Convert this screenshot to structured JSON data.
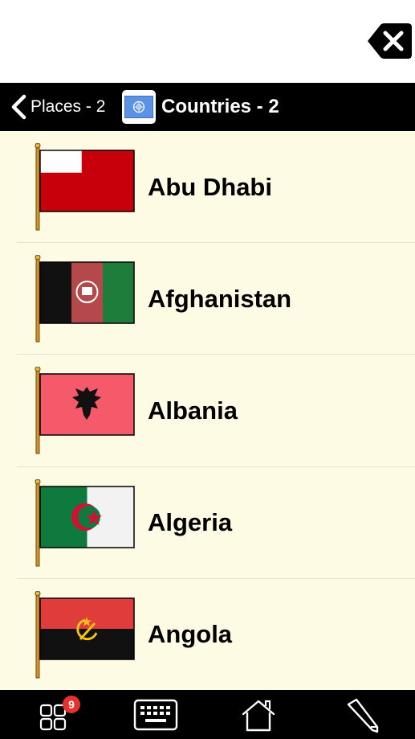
{
  "header": {
    "back_label": "Places - 2",
    "title": "Countries - 2"
  },
  "countries": [
    {
      "name": "Abu Dhabi"
    },
    {
      "name": "Afghanistan"
    },
    {
      "name": "Albania"
    },
    {
      "name": "Algeria"
    },
    {
      "name": "Angola"
    }
  ],
  "toolbar": {
    "grid_badge_count": "9",
    "buttons": [
      "grid-icon",
      "keyboard-icon",
      "home-icon",
      "pencil-icon"
    ]
  },
  "colors": {
    "list_background": "#fdfbe4",
    "bars": "#000000",
    "badge": "#e5322d"
  }
}
